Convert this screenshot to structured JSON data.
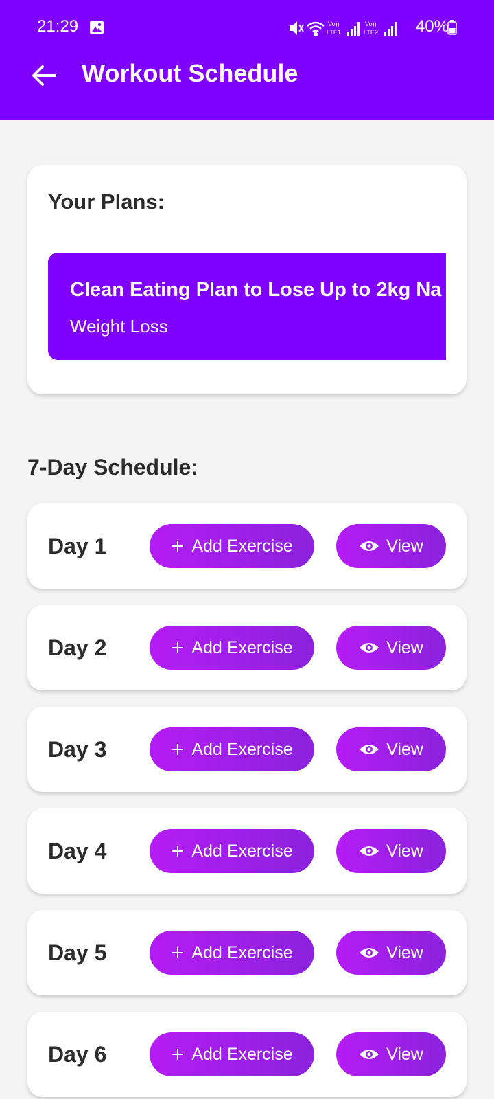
{
  "status_bar": {
    "time": "21:29",
    "battery_percent": "40%",
    "lte1_label": "LTE1",
    "lte2_label": "LTE2",
    "volte_label": "Vo))"
  },
  "toolbar": {
    "title": "Workout Schedule",
    "back_icon": "back-arrow-icon"
  },
  "plans": {
    "heading": "Your Plans:",
    "items": [
      {
        "title": "Clean Eating Plan to Lose Up to 2kg Na",
        "category": "Weight Loss"
      }
    ]
  },
  "schedule": {
    "heading": "7-Day Schedule:",
    "add_label": "Add Exercise",
    "view_label": "View",
    "days": [
      {
        "label": "Day 1"
      },
      {
        "label": "Day 2"
      },
      {
        "label": "Day 3"
      },
      {
        "label": "Day 4"
      },
      {
        "label": "Day 5"
      },
      {
        "label": "Day 6"
      }
    ]
  },
  "colors": {
    "header_bg": "#7f00ff",
    "button_gradient_start": "#b51cf5",
    "button_gradient_end": "#8b22dd",
    "page_bg": "#f4f4f4"
  }
}
